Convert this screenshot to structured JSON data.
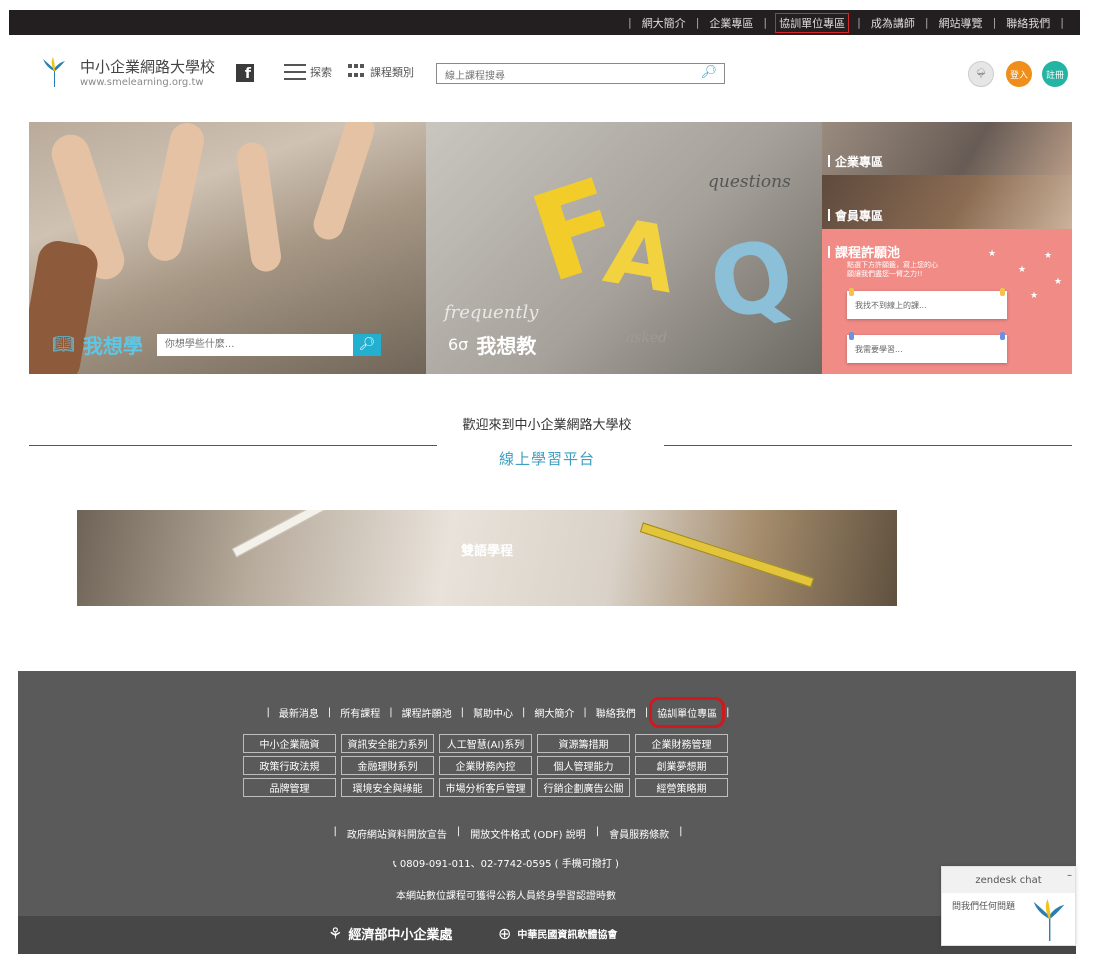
{
  "topnav": {
    "items": [
      "網大簡介",
      "企業專區",
      "協訓單位專區",
      "成為講師",
      "網站導覽",
      "聯絡我們"
    ],
    "highlighted_index": 2
  },
  "header": {
    "site_name": "中小企業網路大學校",
    "site_url": "www.smelearning.org.tw",
    "explore_label": "探索",
    "category_label": "課程類別",
    "search_placeholder": "線上課程搜尋",
    "login_label": "登入",
    "register_label": "註冊"
  },
  "banners": {
    "want_learn": "我想學",
    "want_learn_placeholder": "你想學些什麼...",
    "want_teach": "我想教",
    "faq_words": {
      "top": "questions",
      "left": "frequently",
      "right": "asked"
    },
    "enterprise": "企業專區",
    "member": "會員專區",
    "wish_pool": "課程許願池",
    "wish_desc_line1": "點選下方許願籤，寫上您的心",
    "wish_desc_line2": "願讓我們盡您一臂之力!!",
    "wish_note1": "我找不到線上的課...",
    "wish_note2": "我需要學習..."
  },
  "welcome": {
    "title": "歡迎來到中小企業網路大學校",
    "subtitle": "線上學習平台"
  },
  "bilingual": {
    "label": "雙語學程"
  },
  "footer": {
    "nav": [
      "最新消息",
      "所有課程",
      "課程許願池",
      "幫助中心",
      "網大簡介",
      "聯絡我們",
      "協訓單位專區"
    ],
    "highlighted_index": 6,
    "tags": [
      "中小企業融資",
      "資訊安全能力系列",
      "人工智慧(AI)系列",
      "資源籌措期",
      "企業財務管理",
      "政策行政法規",
      "金融理財系列",
      "企業財務內控",
      "個人管理能力",
      "創業夢想期",
      "品牌管理",
      "環境安全與綠能",
      "市場分析客戶管理",
      "行銷企劃廣告公關",
      "經營策略期"
    ],
    "nav2": [
      "政府網站資料開放宣告",
      "開放文件格式 (ODF) 說明",
      "會員服務條款"
    ],
    "phone": "0809-091-011、02-7742-0595 ( 手機可撥打 )",
    "cert": "本網站數位課程可獲得公務人員終身學習認證時數",
    "org1": "經濟部中小企業處",
    "org2": "中華民國資訊軟體協會"
  },
  "zendesk": {
    "title": "zendesk chat",
    "message": "問我們任何問題"
  },
  "colors": {
    "accent": "#3c9fc0",
    "login": "#ef8e1a",
    "register": "#23b4a3",
    "highlight": "#d0181d",
    "footer_bg": "#5a5a5a"
  }
}
